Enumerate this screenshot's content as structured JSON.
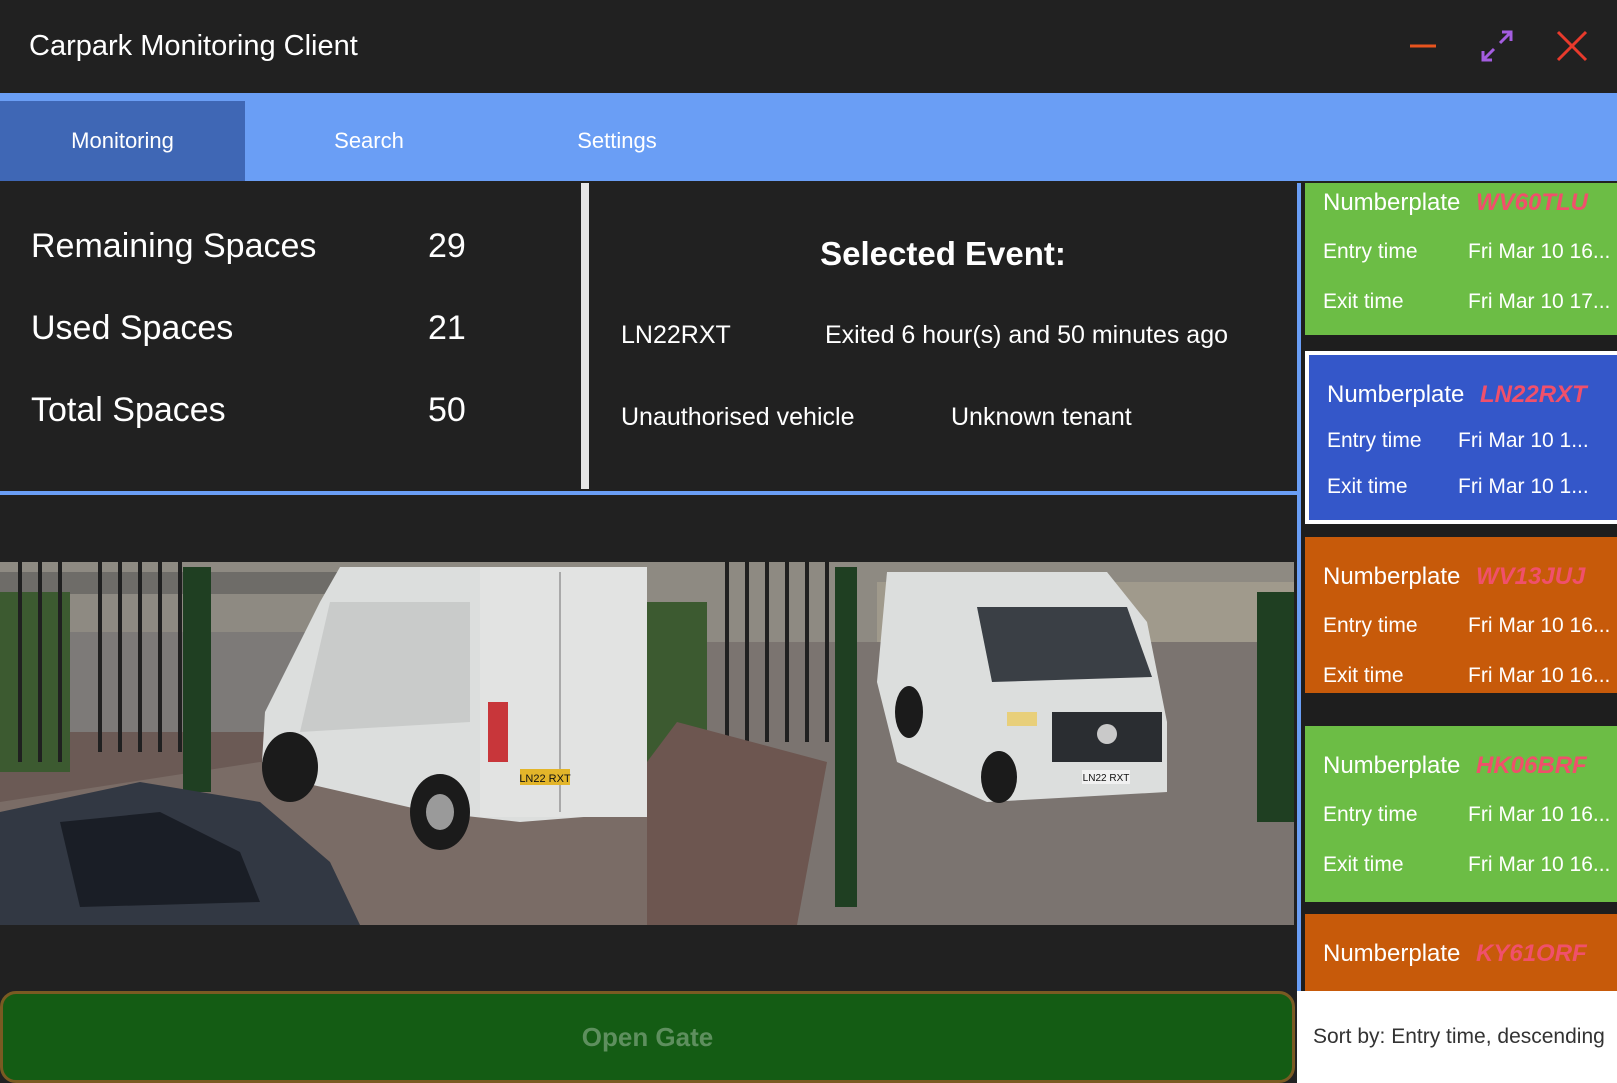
{
  "window": {
    "title": "Carpark Monitoring Client",
    "controls": {
      "minimize_icon": "minimize-icon",
      "maximize_icon": "maximize-icon",
      "close_icon": "close-icon"
    }
  },
  "tabs": [
    {
      "label": "Monitoring",
      "active": true
    },
    {
      "label": "Search",
      "active": false
    },
    {
      "label": "Settings",
      "active": false
    }
  ],
  "stats": {
    "remaining": {
      "label": "Remaining Spaces",
      "value": "29"
    },
    "used": {
      "label": "Used Spaces",
      "value": "21"
    },
    "total": {
      "label": "Total Spaces",
      "value": "50"
    }
  },
  "selected_event": {
    "heading": "Selected Event:",
    "plate": "LN22RXT",
    "status": "Exited 6 hour(s) and 50 minutes ago",
    "authorisation": "Unauthorised vehicle",
    "tenant": "Unknown tenant"
  },
  "cameras": {
    "left_plate": "LN22 RXT",
    "right_plate": "LN22 RXT"
  },
  "open_gate_label": "Open Gate",
  "events": [
    {
      "np_label": "Numberplate",
      "plate": "WV60TLU",
      "entry_label": "Entry time",
      "entry": "Fri Mar 10 16...",
      "exit_label": "Exit time",
      "exit": "Fri Mar 10 17...",
      "color": "#6cbd45"
    },
    {
      "np_label": "Numberplate",
      "plate": "LN22RXT",
      "entry_label": "Entry time",
      "entry": "Fri Mar 10 1...",
      "exit_label": "Exit time",
      "exit": "Fri Mar 10 1...",
      "color": "#3457c9"
    },
    {
      "np_label": "Numberplate",
      "plate": "WV13JUJ",
      "entry_label": "Entry time",
      "entry": "Fri Mar 10 16...",
      "exit_label": "Exit time",
      "exit": "Fri Mar 10 16...",
      "color": "#c75a0a"
    },
    {
      "np_label": "Numberplate",
      "plate": "HK06BRF",
      "entry_label": "Entry time",
      "entry": "Fri Mar 10 16...",
      "exit_label": "Exit time",
      "exit": "Fri Mar 10 16...",
      "color": "#6cbd45"
    },
    {
      "np_label": "Numberplate",
      "plate": "KY61ORF",
      "color": "#c75a0a"
    }
  ],
  "sort_label": "Sort by: Entry time, descending"
}
